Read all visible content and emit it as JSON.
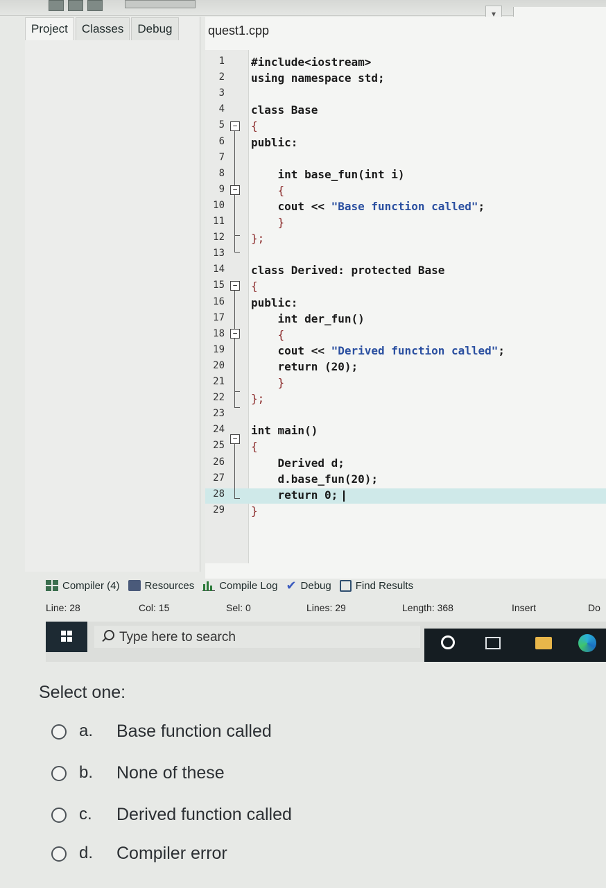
{
  "window": {
    "dropdown_glyph": "▾"
  },
  "project_panel": {
    "tabs": [
      "Project",
      "Classes",
      "Debug"
    ],
    "active_tab": "Project"
  },
  "editor": {
    "file_tab": "quest1.cpp",
    "lines": [
      {
        "n": "1",
        "text": "#include<iostream>"
      },
      {
        "n": "2",
        "text": "using namespace std;"
      },
      {
        "n": "3",
        "text": ""
      },
      {
        "n": "4",
        "text": "class Base"
      },
      {
        "n": "5",
        "text": "{"
      },
      {
        "n": "6",
        "text": "public:"
      },
      {
        "n": "7",
        "text": ""
      },
      {
        "n": "8",
        "text": "    int base_fun(int i)"
      },
      {
        "n": "9",
        "text": "    {"
      },
      {
        "n": "10",
        "text": "    cout << \"Base function called\";"
      },
      {
        "n": "11",
        "text": "    }"
      },
      {
        "n": "12",
        "text": "};"
      },
      {
        "n": "13",
        "text": ""
      },
      {
        "n": "14",
        "text": "class Derived: protected Base"
      },
      {
        "n": "15",
        "text": "{"
      },
      {
        "n": "16",
        "text": "public:"
      },
      {
        "n": "17",
        "text": "    int der_fun()"
      },
      {
        "n": "18",
        "text": "    {"
      },
      {
        "n": "19",
        "text": "    cout << \"Derived function called\";"
      },
      {
        "n": "20",
        "text": "    return (20);"
      },
      {
        "n": "21",
        "text": "    }"
      },
      {
        "n": "22",
        "text": "};"
      },
      {
        "n": "23",
        "text": ""
      },
      {
        "n": "24",
        "text": "int main()"
      },
      {
        "n": "25",
        "text": "{"
      },
      {
        "n": "26",
        "text": "    Derived d;"
      },
      {
        "n": "27",
        "text": "    d.base_fun(20);"
      },
      {
        "n": "28",
        "text": "    return 0;"
      },
      {
        "n": "29",
        "text": "}"
      }
    ],
    "current_line": "28",
    "highlight_color": "#cfe9e9"
  },
  "tool_tabs": [
    {
      "label": "Compiler (4)",
      "icon": "compiler-grid-icon"
    },
    {
      "label": "Resources",
      "icon": "resources-icon"
    },
    {
      "label": "Compile Log",
      "icon": "bar-chart-icon"
    },
    {
      "label": "Debug",
      "icon": "check-icon"
    },
    {
      "label": "Find Results",
      "icon": "find-icon"
    }
  ],
  "statusbar": {
    "line_label": "Line:",
    "line_value": "28",
    "col_label": "Col:",
    "col_value": "15",
    "sel_label": "Sel:",
    "sel_value": "0",
    "lines_label": "Lines:",
    "lines_value": "29",
    "length_label": "Length:",
    "length_value": "368",
    "mode": "Insert",
    "extra": "Do"
  },
  "taskbar": {
    "search_placeholder": "Type here to search"
  },
  "quiz": {
    "prompt": "Select one:",
    "options": [
      {
        "letter": "a.",
        "text": "Base function called"
      },
      {
        "letter": "b.",
        "text": "None of these"
      },
      {
        "letter": "c.",
        "text": "Derived function called"
      },
      {
        "letter": "d.",
        "text": "Compiler error"
      }
    ]
  }
}
